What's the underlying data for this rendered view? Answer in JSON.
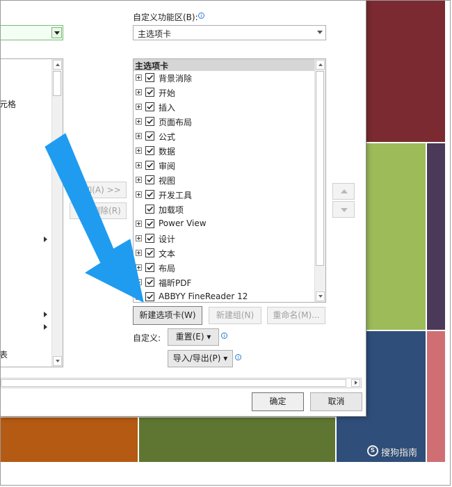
{
  "background_tiles": {
    "colors": [
      "#7a2a30",
      "#9dbb59",
      "#4a3958",
      "#2f4e7a",
      "#cf6f74",
      "#b55a12",
      "#5f7632"
    ]
  },
  "dialog": {
    "customize_ribbon_label": "自定义功能区(B):",
    "ribbon_combo_value": "主选项卡",
    "left_list_partial_text": "元格",
    "left_list_bottom_char": "表",
    "add_button": "添加(A) >>",
    "remove_button": "<< 删除(R)",
    "tree_header": "主选项卡",
    "tree_items": [
      {
        "label": "背景消除",
        "expander": true
      },
      {
        "label": "开始",
        "expander": true
      },
      {
        "label": "插入",
        "expander": true
      },
      {
        "label": "页面布局",
        "expander": true
      },
      {
        "label": "公式",
        "expander": true
      },
      {
        "label": "数据",
        "expander": true
      },
      {
        "label": "审阅",
        "expander": true
      },
      {
        "label": "视图",
        "expander": true
      },
      {
        "label": "开发工具",
        "expander": true
      },
      {
        "label": "加载项",
        "expander": false
      },
      {
        "label": "Power View",
        "expander": true
      },
      {
        "label": "设计",
        "expander": true
      },
      {
        "label": "文本",
        "expander": true
      },
      {
        "label": "布局",
        "expander": true
      },
      {
        "label": "福昕PDF",
        "expander": true
      },
      {
        "label": "ABBYY FineReader 12",
        "expander": true
      }
    ],
    "new_tab_button": "新建选项卡(W)",
    "new_group_button": "新建组(N)",
    "rename_button": "重命名(M)...",
    "customize_label": "自定义:",
    "reset_button": "重置(E) ▾",
    "import_export_button": "导入/导出(P) ▾",
    "ok_button": "确定",
    "cancel_button": "取消",
    "accent_arrow_color": "#1f9cf0"
  },
  "watermark": {
    "text": "搜狗指南",
    "icon": "S"
  }
}
